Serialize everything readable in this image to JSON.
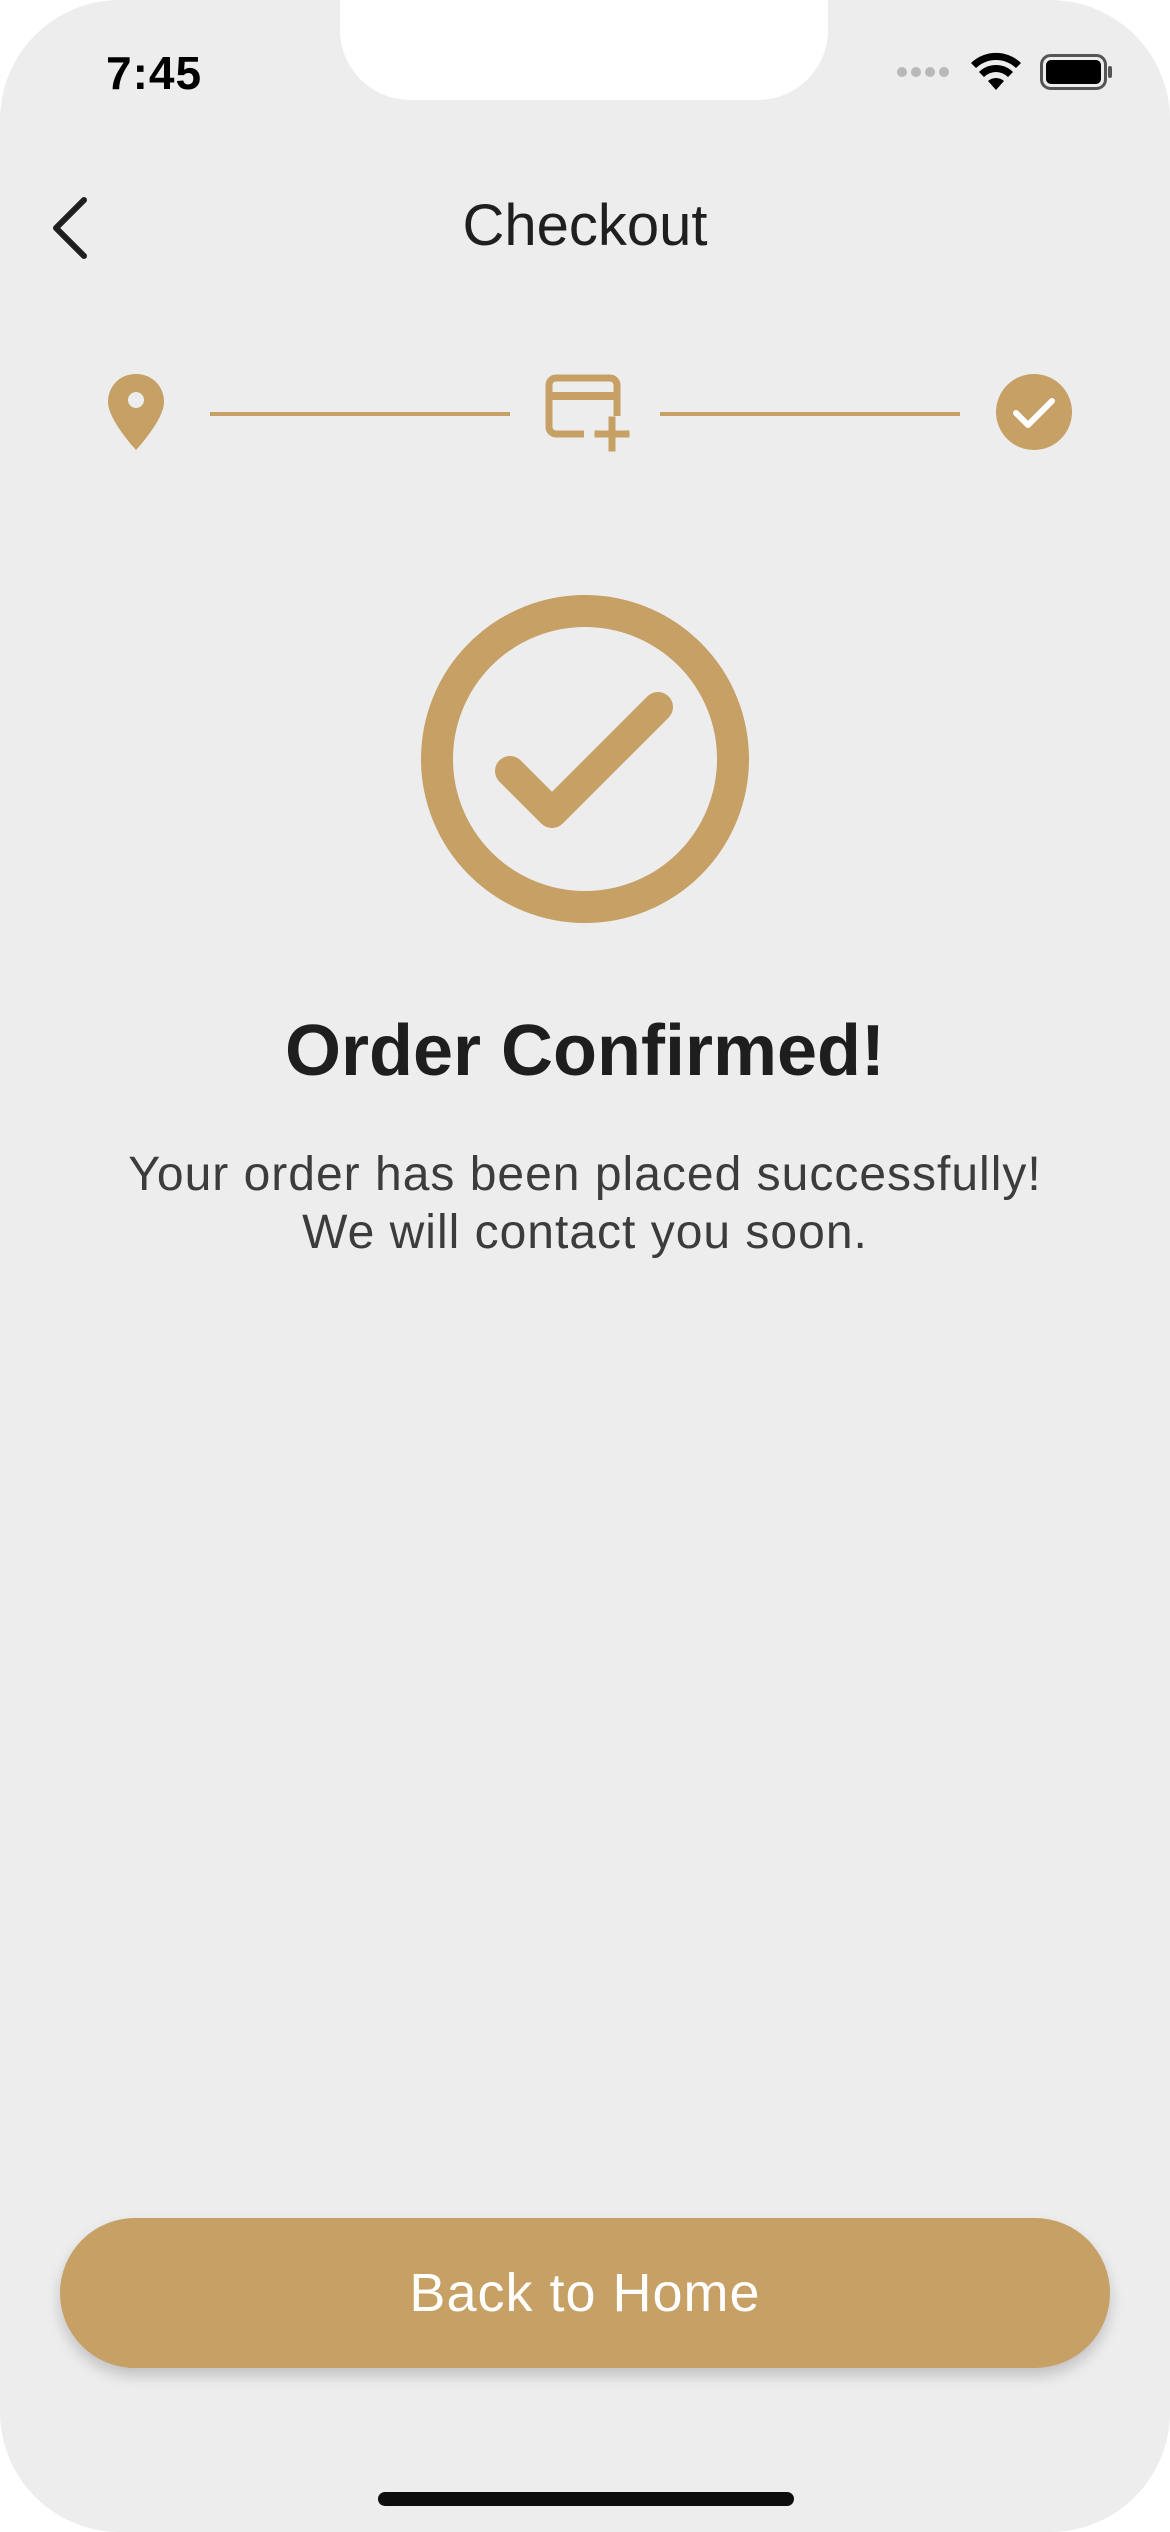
{
  "status_bar": {
    "time": "7:45",
    "icons": [
      "signal-dots-icon",
      "wifi-icon",
      "battery-icon"
    ]
  },
  "header": {
    "title": "Checkout",
    "back_icon": "chevron-left-icon"
  },
  "stepper": {
    "steps": [
      {
        "icon": "location-pin-icon",
        "state": "completed"
      },
      {
        "icon": "credit-card-add-icon",
        "state": "completed"
      },
      {
        "icon": "check-circle-icon",
        "state": "current"
      }
    ]
  },
  "confirmation": {
    "icon": "check-circle-outline-icon",
    "title": "Order Confirmed!",
    "message_line1": "Your order has been placed successfully!",
    "message_line2": "We will contact you soon."
  },
  "actions": {
    "back_home_label": "Back to Home"
  },
  "colors": {
    "accent": "#c6a064",
    "background": "#ededee",
    "text_primary": "#1e1e1e",
    "text_secondary": "#3c3c3c"
  }
}
